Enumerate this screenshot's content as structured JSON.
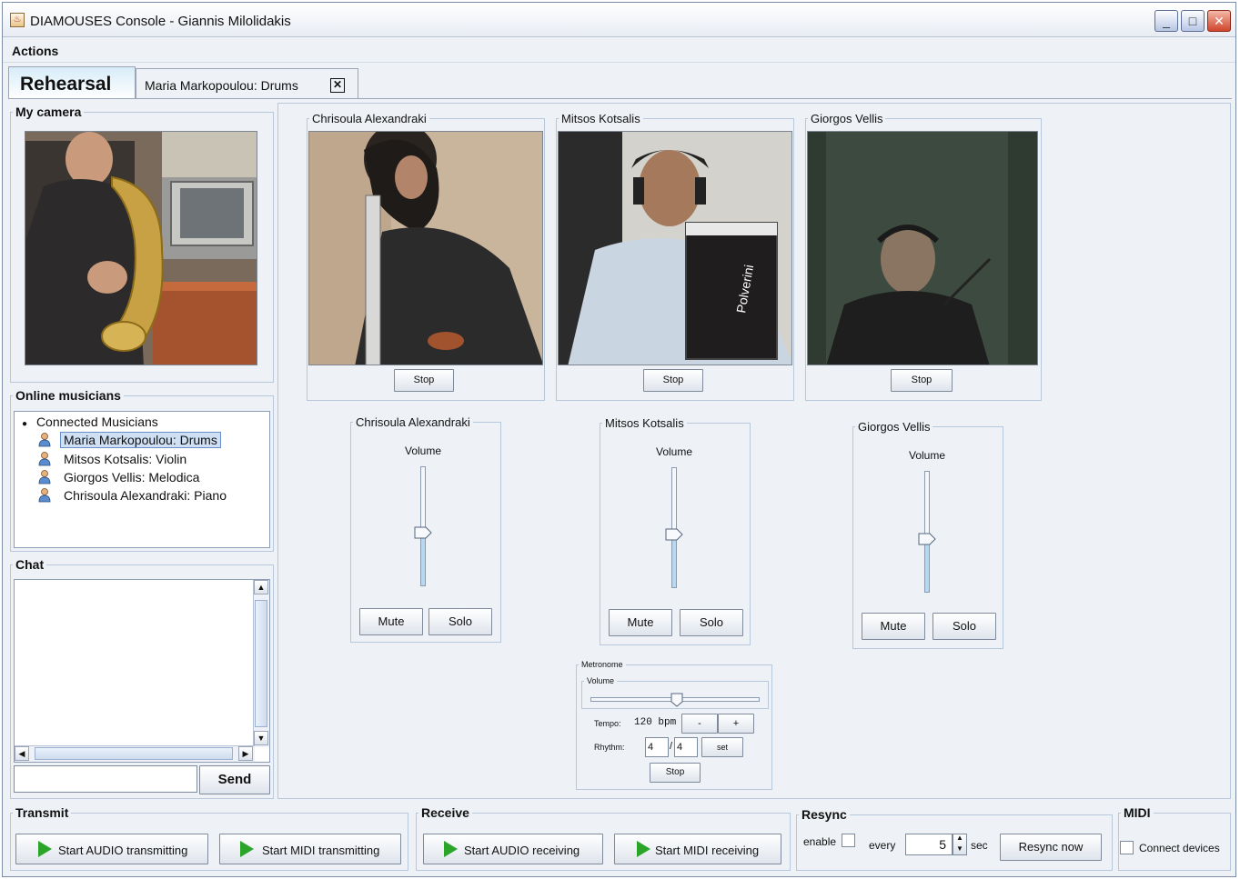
{
  "window": {
    "title": "DIAMOUSES Console - Giannis Milolidakis"
  },
  "menu": {
    "actions": "Actions"
  },
  "tabs": {
    "rehearsal": "Rehearsal",
    "secondary": "Maria Markopoulou: Drums"
  },
  "my_camera": {
    "label": "My camera"
  },
  "online": {
    "label": "Online musicians",
    "root": "Connected Musicians",
    "items": [
      "Maria Markopoulou: Drums",
      "Mitsos Kotsalis: Violin",
      "Giorgos Vellis: Melodica",
      "Chrisoula Alexandraki: Piano"
    ],
    "selected_index": 0
  },
  "chat": {
    "label": "Chat",
    "input_value": "",
    "send": "Send"
  },
  "remote_videos": [
    {
      "name": "Chrisoula Alexandraki",
      "stop": "Stop"
    },
    {
      "name": "Mitsos Kotsalis",
      "stop": "Stop"
    },
    {
      "name": "Giorgos Vellis",
      "stop": "Stop"
    }
  ],
  "mixers": [
    {
      "name": "Chrisoula Alexandraki",
      "volume_label": "Volume",
      "volume": 0.45,
      "mute": "Mute",
      "solo": "Solo"
    },
    {
      "name": "Mitsos Kotsalis",
      "volume_label": "Volume",
      "volume": 0.44,
      "mute": "Mute",
      "solo": "Solo"
    },
    {
      "name": "Giorgos Vellis",
      "volume_label": "Volume",
      "volume": 0.44,
      "mute": "Mute",
      "solo": "Solo"
    }
  ],
  "metronome": {
    "label": "Metronome",
    "volume_label": "Volume",
    "volume": 0.51,
    "tempo_label": "Tempo:",
    "tempo_value": "120 bpm",
    "minus": "-",
    "plus": "+",
    "rhythm_label": "Rhythm:",
    "rhythm_num": "4",
    "rhythm_sep": "/",
    "rhythm_den": "4",
    "set": "set",
    "stop": "Stop"
  },
  "transmit": {
    "label": "Transmit",
    "audio": "Start AUDIO transmitting",
    "midi": "Start MIDI transmitting"
  },
  "receive": {
    "label": "Receive",
    "audio": "Start AUDIO receiving",
    "midi": "Start MIDI receiving"
  },
  "resync": {
    "label": "Resync",
    "enable": "enable",
    "every": "every",
    "value": "5",
    "unit": "sec",
    "button": "Resync now"
  },
  "midi": {
    "label": "MIDI",
    "connect": "Connect devices"
  },
  "colors": {
    "accent": "#b9d7ef",
    "border": "#b7c8dc",
    "play_green": "#2aa52a",
    "selection": "#cfe0f5"
  }
}
